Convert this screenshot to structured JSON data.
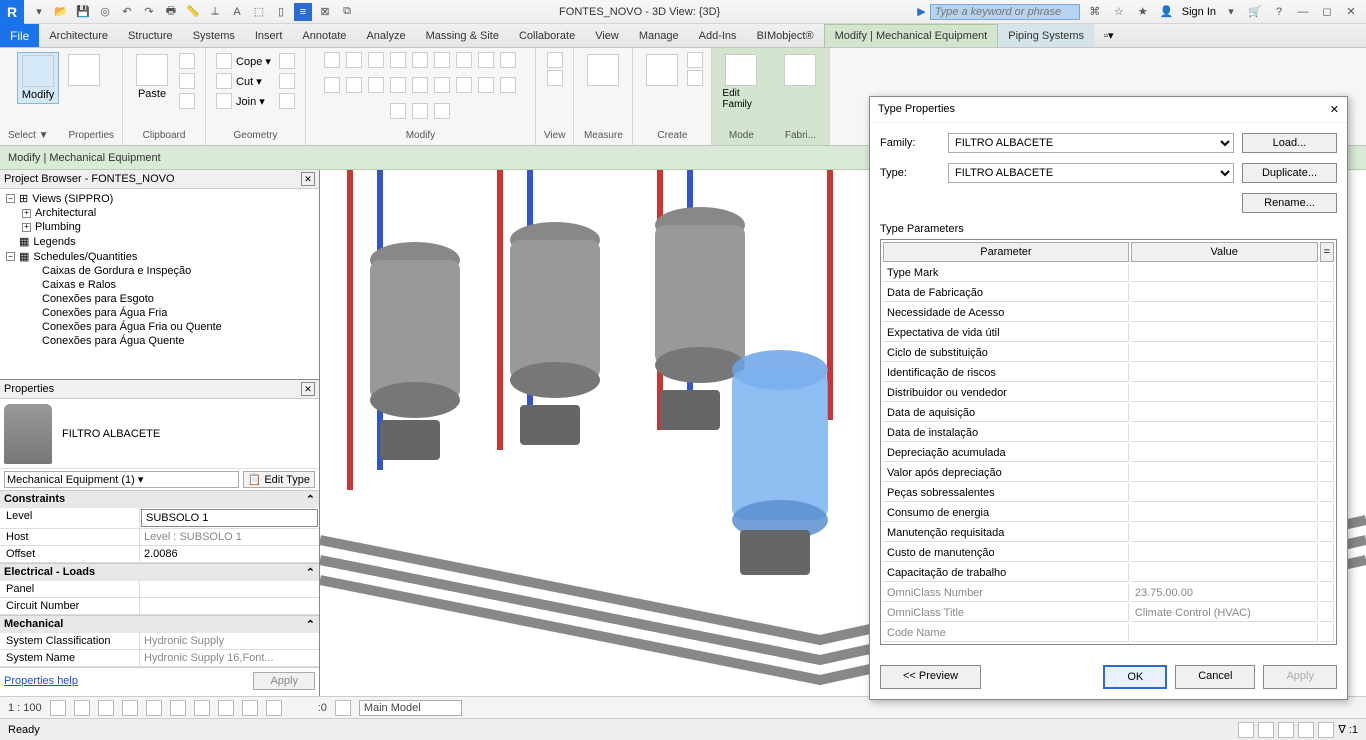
{
  "titlebar": {
    "title": "FONTES_NOVO - 3D View: {3D}",
    "search_placeholder": "Type a keyword or phrase",
    "signin": "Sign In"
  },
  "menu": {
    "file": "File",
    "tabs": [
      "Architecture",
      "Structure",
      "Systems",
      "Insert",
      "Annotate",
      "Analyze",
      "Massing & Site",
      "Collaborate",
      "View",
      "Manage",
      "Add-Ins",
      "BIMobject®",
      "Modify | Mechanical Equipment",
      "Piping Systems"
    ]
  },
  "ribbon": {
    "modify": "Modify",
    "select": "Select ▼",
    "properties": "Properties",
    "paste": "Paste",
    "clipboard": "Clipboard",
    "cope": "Cope ▾",
    "cut": "Cut ▾",
    "join": "Join ▾",
    "geometry": "Geometry",
    "modify2": "Modify",
    "view": "View",
    "measure": "Measure",
    "create": "Create",
    "editfamily": "Edit Family",
    "fabri": "Fabri...",
    "mode": "Mode"
  },
  "contextbar": "Modify | Mechanical Equipment",
  "projectbrowser": {
    "title": "Project Browser - FONTES_NOVO",
    "views": "Views (SIPPRO)",
    "arch": "Architectural",
    "plumb": "Plumbing",
    "legends": "Legends",
    "sched": "Schedules/Quantities",
    "items": [
      "Caixas de Gordura e Inspeção",
      "Caixas e Ralos",
      "Conexões para Esgoto",
      "Conexões para Água Fria",
      "Conexões para Água Fria ou Quente",
      "Conexões para Água Quente"
    ]
  },
  "properties": {
    "title": "Properties",
    "typename": "FILTRO ALBACETE",
    "category": "Mechanical Equipment (1)",
    "edittype": "Edit Type",
    "groups": {
      "constraints": "Constraints",
      "electrical": "Electrical - Loads",
      "mechanical": "Mechanical"
    },
    "rows": {
      "level_k": "Level",
      "level_v": "SUBSOLO 1",
      "host_k": "Host",
      "host_v": "Level : SUBSOLO 1",
      "offset_k": "Offset",
      "offset_v": "2.0086",
      "panel_k": "Panel",
      "panel_v": "",
      "circuit_k": "Circuit Number",
      "circuit_v": "",
      "sysclass_k": "System Classification",
      "sysclass_v": "Hydronic Supply",
      "sysname_k": "System Name",
      "sysname_v": "Hydronic Supply 16,Font..."
    },
    "help": "Properties help",
    "apply": "Apply"
  },
  "dialog": {
    "title": "Type Properties",
    "family_lbl": "Family:",
    "type_lbl": "Type:",
    "family": "FILTRO ALBACETE",
    "type": "FILTRO ALBACETE",
    "load": "Load...",
    "duplicate": "Duplicate...",
    "rename": "Rename...",
    "section": "Type Parameters",
    "col_param": "Parameter",
    "col_value": "Value",
    "params": [
      {
        "k": "Type Mark",
        "v": ""
      },
      {
        "k": "Data de Fabricação",
        "v": ""
      },
      {
        "k": "Necessidade de Acesso",
        "v": ""
      },
      {
        "k": "Expectativa de vida útil",
        "v": ""
      },
      {
        "k": "Ciclo de substituição",
        "v": ""
      },
      {
        "k": "Identificação de riscos",
        "v": ""
      },
      {
        "k": "Distribuidor ou vendedor",
        "v": ""
      },
      {
        "k": "Data de aquisição",
        "v": ""
      },
      {
        "k": "Data de instalação",
        "v": ""
      },
      {
        "k": "Depreciação acumulada",
        "v": ""
      },
      {
        "k": "Valor após depreciação",
        "v": ""
      },
      {
        "k": "Peças sobressalentes",
        "v": ""
      },
      {
        "k": "Consumo de energia",
        "v": ""
      },
      {
        "k": "Manutenção requisitada",
        "v": ""
      },
      {
        "k": "Custo de manutenção",
        "v": ""
      },
      {
        "k": "Capacitação de trabalho",
        "v": ""
      },
      {
        "k": "OmniClass Number",
        "v": "23.75.00.00",
        "gray": true
      },
      {
        "k": "OmniClass Title",
        "v": "Climate Control (HVAC)",
        "gray": true
      },
      {
        "k": "Code Name",
        "v": "",
        "gray": true
      }
    ],
    "preview": "<< Preview",
    "ok": "OK",
    "cancel": "Cancel",
    "apply": "Apply"
  },
  "viewctrl": {
    "scale": "1 : 100",
    "mainmodel": "Main Model"
  },
  "status": {
    "ready": "Ready",
    "zero": ":0"
  }
}
